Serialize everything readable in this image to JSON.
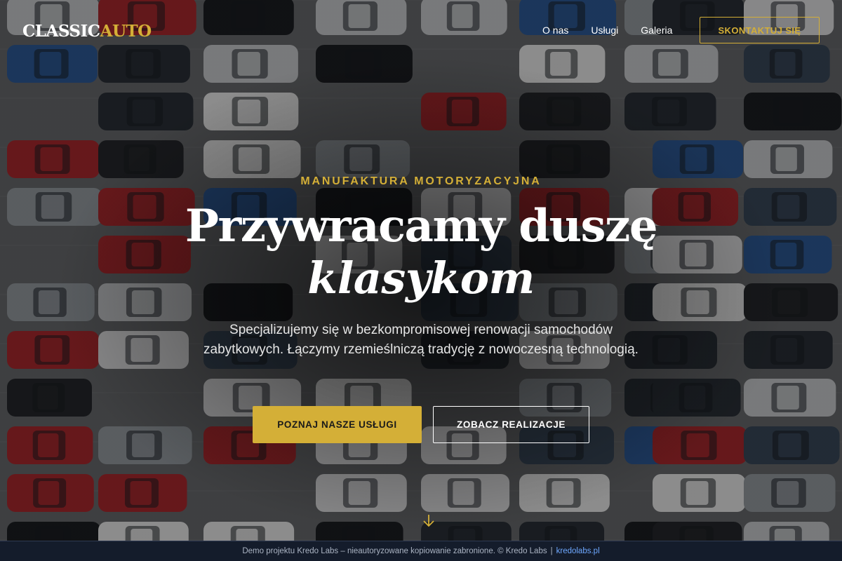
{
  "header": {
    "logo_main": "CLASSIC",
    "logo_accent": "AUTO",
    "nav": [
      "O nas",
      "Usługi",
      "Galeria"
    ],
    "contact_button": "SKONTAKTUJ SIĘ"
  },
  "hero": {
    "eyebrow": "MANUFAKTURA MOTORYZACYJNA",
    "headline_line1": "Przywracamy duszę",
    "headline_line2": "klasykom",
    "subtitle": "Specjalizujemy się w bezkompromisowej renowacji samochodów zabytkowych. Łączymy rzemieślniczą tradycję z nowoczesną technologią.",
    "primary_button": "POZNAJ NASZE USŁUGI",
    "secondary_button": "ZOBACZ REALIZACJE"
  },
  "footer": {
    "notice": "Demo projektu Kredo Labs – nieautoryzowane kopiowanie zabronione. © Kredo Labs",
    "separator": "|",
    "link": "kredolabs.pl"
  },
  "colors": {
    "accent": "#d4af37",
    "footer_bg": "#141c2b",
    "footer_link": "#6ea8ff",
    "text": "#ffffff"
  },
  "icons": {
    "scroll": "arrow-down-icon"
  }
}
